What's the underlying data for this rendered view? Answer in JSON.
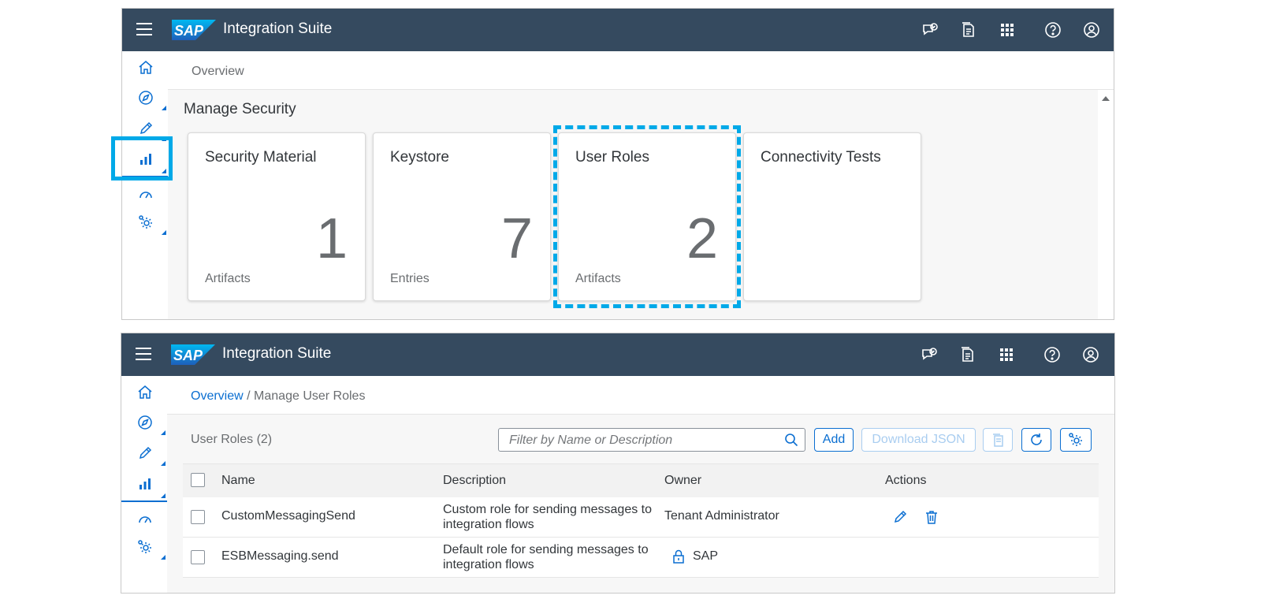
{
  "shell": {
    "logo_text": "SAP",
    "app_title": "Integration Suite",
    "icons": [
      "feedback-icon",
      "notes-icon",
      "app-grid-icon",
      "help-icon",
      "user-icon"
    ]
  },
  "sidenav": {
    "items": [
      "home-icon",
      "discover-icon",
      "design-icon",
      "monitor-icon",
      "monitor-performance-icon",
      "settings-icon"
    ]
  },
  "top_panel": {
    "breadcrumb": "Overview",
    "section_title": "Manage Security",
    "tiles": [
      {
        "title": "Security Material",
        "number": "1",
        "unit": "Artifacts"
      },
      {
        "title": "Keystore",
        "number": "7",
        "unit": "Entries"
      },
      {
        "title": "User Roles",
        "number": "2",
        "unit": "Artifacts"
      },
      {
        "title": "Connectivity Tests",
        "number": "",
        "unit": ""
      }
    ]
  },
  "bottom_panel": {
    "breadcrumb_link": "Overview",
    "breadcrumb_sep": "/",
    "breadcrumb_current": "Manage User Roles",
    "table_title": "User Roles (2)",
    "search_placeholder": "Filter by Name or Description",
    "add_label": "Add",
    "download_label": "Download JSON",
    "columns": [
      "Name",
      "Description",
      "Owner",
      "Actions"
    ],
    "rows": [
      {
        "name": "CustomMessagingSend",
        "description": "Custom role for sending messages to integration flows",
        "owner": "Tenant Administrator",
        "owner_locked": false
      },
      {
        "name": "ESBMessaging.send",
        "description": "Default role for sending messages to integration flows",
        "owner": "SAP",
        "owner_locked": true
      }
    ]
  },
  "colors": {
    "shell_bg": "#354a5f",
    "accent": "#0a6ed1",
    "highlight": "#00a9e8"
  }
}
